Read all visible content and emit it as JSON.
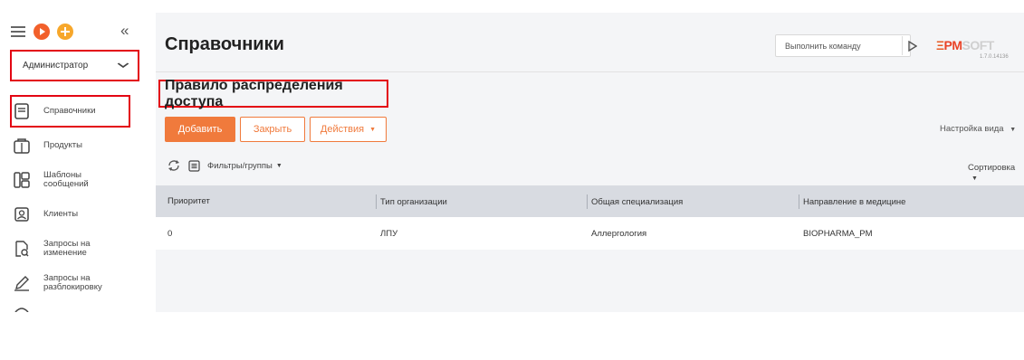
{
  "sidebar": {
    "role": "Администратор",
    "items": [
      {
        "label": "Справочники",
        "icon": "book-icon",
        "active": true
      },
      {
        "label": "Продукты",
        "icon": "product-icon"
      },
      {
        "label": "Шаблоны сообщений",
        "icon": "template-icon"
      },
      {
        "label": "Клиенты",
        "icon": "client-icon"
      },
      {
        "label": "Запросы на изменение",
        "icon": "change-request-icon"
      },
      {
        "label": "Запросы на разблокировку",
        "icon": "pencil-icon"
      }
    ]
  },
  "header": {
    "title": "Справочники",
    "command_placeholder": "Выполнить команду",
    "logo_parts": [
      "Ξ",
      "PM",
      "SOFT"
    ],
    "version": "1.7.0.14136"
  },
  "section": {
    "title": "Правило распределения доступа"
  },
  "toolbar": {
    "add_label": "Добавить",
    "close_label": "Закрыть",
    "actions_label": "Действия",
    "view_settings": "Настройка вида"
  },
  "filters": {
    "label": "Фильтры/группы",
    "sort_label": "Сортировка"
  },
  "grid": {
    "columns": [
      "Приоритет",
      "Тип организации",
      "Общая специализация",
      "Направление в медицине"
    ],
    "rows": [
      [
        "0",
        "ЛПУ",
        "Аллергология",
        "BIOPHARMA_PM"
      ]
    ]
  },
  "colors": {
    "accent": "#f07a3c",
    "highlight": "#e30613"
  }
}
